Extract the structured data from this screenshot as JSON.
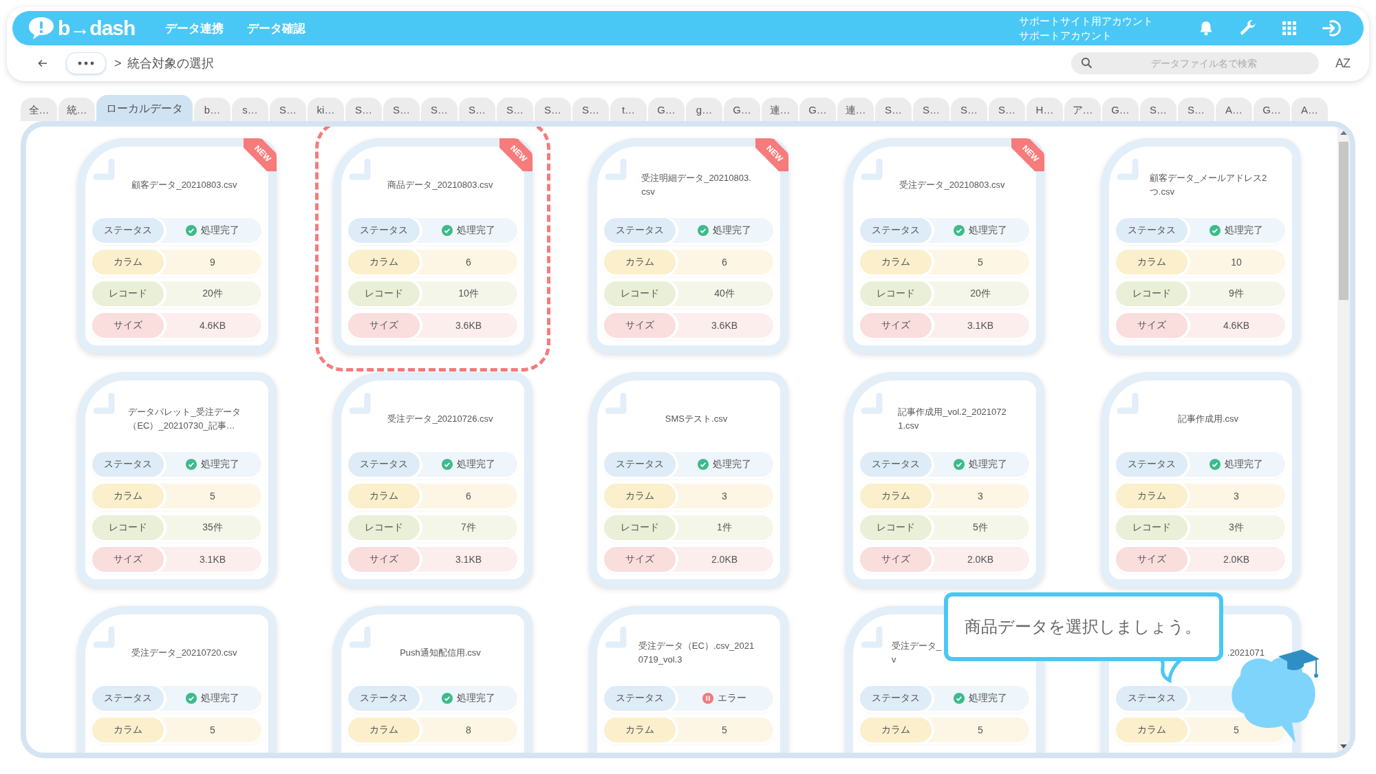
{
  "header": {
    "logo": "b→dash",
    "nav": [
      "データ連携",
      "データ確認"
    ],
    "account_lines": [
      "サポートサイト用アカウント",
      "サポートアカウント"
    ]
  },
  "toolbar": {
    "breadcrumb_separator": ">",
    "breadcrumb": "統合対象の選択",
    "search": {
      "placeholder": "データファイル名で検索"
    },
    "sort_label": "AZ"
  },
  "tabs": [
    {
      "label": "全…",
      "selected": false
    },
    {
      "label": "統…",
      "selected": false
    },
    {
      "label": "ローカルデータ",
      "selected": true
    },
    {
      "label": "b…",
      "selected": false
    },
    {
      "label": "s…",
      "selected": false
    },
    {
      "label": "S…",
      "selected": false
    },
    {
      "label": "ki…",
      "selected": false
    },
    {
      "label": "S…",
      "selected": false
    },
    {
      "label": "S…",
      "selected": false
    },
    {
      "label": "S…",
      "selected": false
    },
    {
      "label": "S…",
      "selected": false
    },
    {
      "label": "S…",
      "selected": false
    },
    {
      "label": "S…",
      "selected": false
    },
    {
      "label": "S…",
      "selected": false
    },
    {
      "label": "t…",
      "selected": false
    },
    {
      "label": "G…",
      "selected": false
    },
    {
      "label": "g…",
      "selected": false
    },
    {
      "label": "G…",
      "selected": false
    },
    {
      "label": "連…",
      "selected": false
    },
    {
      "label": "G…",
      "selected": false
    },
    {
      "label": "連…",
      "selected": false
    },
    {
      "label": "S…",
      "selected": false
    },
    {
      "label": "S…",
      "selected": false
    },
    {
      "label": "S…",
      "selected": false
    },
    {
      "label": "S…",
      "selected": false
    },
    {
      "label": "H…",
      "selected": false
    },
    {
      "label": "ア…",
      "selected": false
    },
    {
      "label": "G…",
      "selected": false
    },
    {
      "label": "S…",
      "selected": false
    },
    {
      "label": "S…",
      "selected": false
    },
    {
      "label": "A…",
      "selected": false
    },
    {
      "label": "G…",
      "selected": false
    },
    {
      "label": "A…",
      "selected": false
    }
  ],
  "cards": [
    {
      "title_lines": [
        "顧客データ_20210803.csv"
      ],
      "ribbon": "NEW",
      "selected": false,
      "rows": [
        {
          "kind": "status",
          "label": "ステータス",
          "error": false,
          "value": "処理完了"
        },
        {
          "kind": "column",
          "label": "カラム",
          "value": "9"
        },
        {
          "kind": "record",
          "label": "レコード",
          "value": "20件"
        },
        {
          "kind": "size",
          "label": "サイズ",
          "value": "4.6KB"
        }
      ]
    },
    {
      "title_lines": [
        "商品データ_20210803.csv"
      ],
      "ribbon": "NEW",
      "selected": true,
      "rows": [
        {
          "kind": "status",
          "label": "ステータス",
          "error": false,
          "value": "処理完了"
        },
        {
          "kind": "column",
          "label": "カラム",
          "value": "6"
        },
        {
          "kind": "record",
          "label": "レコード",
          "value": "10件"
        },
        {
          "kind": "size",
          "label": "サイズ",
          "value": "3.6KB"
        }
      ]
    },
    {
      "title_lines": [
        "受注明細データ_20210803.",
        "csv"
      ],
      "ribbon": "NEW",
      "selected": false,
      "rows": [
        {
          "kind": "status",
          "label": "ステータス",
          "error": false,
          "value": "処理完了"
        },
        {
          "kind": "column",
          "label": "カラム",
          "value": "6"
        },
        {
          "kind": "record",
          "label": "レコード",
          "value": "40件"
        },
        {
          "kind": "size",
          "label": "サイズ",
          "value": "3.6KB"
        }
      ]
    },
    {
      "title_lines": [
        "受注データ_20210803.csv"
      ],
      "ribbon": "NEW",
      "selected": false,
      "rows": [
        {
          "kind": "status",
          "label": "ステータス",
          "error": false,
          "value": "処理完了"
        },
        {
          "kind": "column",
          "label": "カラム",
          "value": "5"
        },
        {
          "kind": "record",
          "label": "レコード",
          "value": "20件"
        },
        {
          "kind": "size",
          "label": "サイズ",
          "value": "3.1KB"
        }
      ]
    },
    {
      "title_lines": [
        "顧客データ_メールアドレス2",
        "つ.csv"
      ],
      "selected": false,
      "rows": [
        {
          "kind": "status",
          "label": "ステータス",
          "error": false,
          "value": "処理完了"
        },
        {
          "kind": "column",
          "label": "カラム",
          "value": "10"
        },
        {
          "kind": "record",
          "label": "レコード",
          "value": "9件"
        },
        {
          "kind": "size",
          "label": "サイズ",
          "value": "4.6KB"
        }
      ]
    },
    {
      "title_lines": [
        "データパレット_受注データ",
        "（EC）_20210730_記事…"
      ],
      "selected": false,
      "rows": [
        {
          "kind": "status",
          "label": "ステータス",
          "error": false,
          "value": "処理完了"
        },
        {
          "kind": "column",
          "label": "カラム",
          "value": "5"
        },
        {
          "kind": "record",
          "label": "レコード",
          "value": "35件"
        },
        {
          "kind": "size",
          "label": "サイズ",
          "value": "3.1KB"
        }
      ]
    },
    {
      "title_lines": [
        "受注データ_20210726.csv"
      ],
      "selected": false,
      "rows": [
        {
          "kind": "status",
          "label": "ステータス",
          "error": false,
          "value": "処理完了"
        },
        {
          "kind": "column",
          "label": "カラム",
          "value": "6"
        },
        {
          "kind": "record",
          "label": "レコード",
          "value": "7件"
        },
        {
          "kind": "size",
          "label": "サイズ",
          "value": "3.1KB"
        }
      ]
    },
    {
      "title_lines": [
        "SMSテスト.csv"
      ],
      "selected": false,
      "rows": [
        {
          "kind": "status",
          "label": "ステータス",
          "error": false,
          "value": "処理完了"
        },
        {
          "kind": "column",
          "label": "カラム",
          "value": "3"
        },
        {
          "kind": "record",
          "label": "レコード",
          "value": "1件"
        },
        {
          "kind": "size",
          "label": "サイズ",
          "value": "2.0KB"
        }
      ]
    },
    {
      "title_lines": [
        "記事作成用_vol.2_2021072",
        "1.csv"
      ],
      "selected": false,
      "rows": [
        {
          "kind": "status",
          "label": "ステータス",
          "error": false,
          "value": "処理完了"
        },
        {
          "kind": "column",
          "label": "カラム",
          "value": "3"
        },
        {
          "kind": "record",
          "label": "レコード",
          "value": "5件"
        },
        {
          "kind": "size",
          "label": "サイズ",
          "value": "2.0KB"
        }
      ]
    },
    {
      "title_lines": [
        "記事作成用.csv"
      ],
      "selected": false,
      "rows": [
        {
          "kind": "status",
          "label": "ステータス",
          "error": false,
          "value": "処理完了"
        },
        {
          "kind": "column",
          "label": "カラム",
          "value": "3"
        },
        {
          "kind": "record",
          "label": "レコード",
          "value": "3件"
        },
        {
          "kind": "size",
          "label": "サイズ",
          "value": "2.0KB"
        }
      ]
    },
    {
      "title_lines": [
        "受注データ_20210720.csv"
      ],
      "selected": false,
      "rows": [
        {
          "kind": "status",
          "label": "ステータス",
          "error": false,
          "value": "処理完了"
        },
        {
          "kind": "column",
          "label": "カラム",
          "value": "5"
        }
      ]
    },
    {
      "title_lines": [
        "Push通知配信用.csv"
      ],
      "selected": false,
      "rows": [
        {
          "kind": "status",
          "label": "ステータス",
          "error": false,
          "value": "処理完了"
        },
        {
          "kind": "column",
          "label": "カラム",
          "value": "8"
        }
      ]
    },
    {
      "title_lines": [
        "受注データ（EC）.csv_2021",
        "0719_vol.3"
      ],
      "selected": false,
      "rows": [
        {
          "kind": "status",
          "label": "ステータス",
          "error": true,
          "value": "エラー"
        },
        {
          "kind": "column",
          "label": "カラム",
          "value": "5"
        }
      ]
    },
    {
      "title_lines": [
        "受注データ_",
        "v"
      ],
      "title_clipped_right": true,
      "selected": false,
      "rows": [
        {
          "kind": "status",
          "label": "ステータス",
          "error": false,
          "value": "処理完了"
        },
        {
          "kind": "column",
          "label": "カラム",
          "value": "5"
        }
      ]
    },
    {
      "title_lines": [
        ".2021071"
      ],
      "title_clipped_left": true,
      "selected": false,
      "rows": [
        {
          "kind": "status",
          "label": "ステータス"
        },
        {
          "kind": "column",
          "label": "カラム",
          "value": "5"
        }
      ]
    }
  ],
  "tooltip": {
    "text": "商品データを選択しましょう。"
  }
}
